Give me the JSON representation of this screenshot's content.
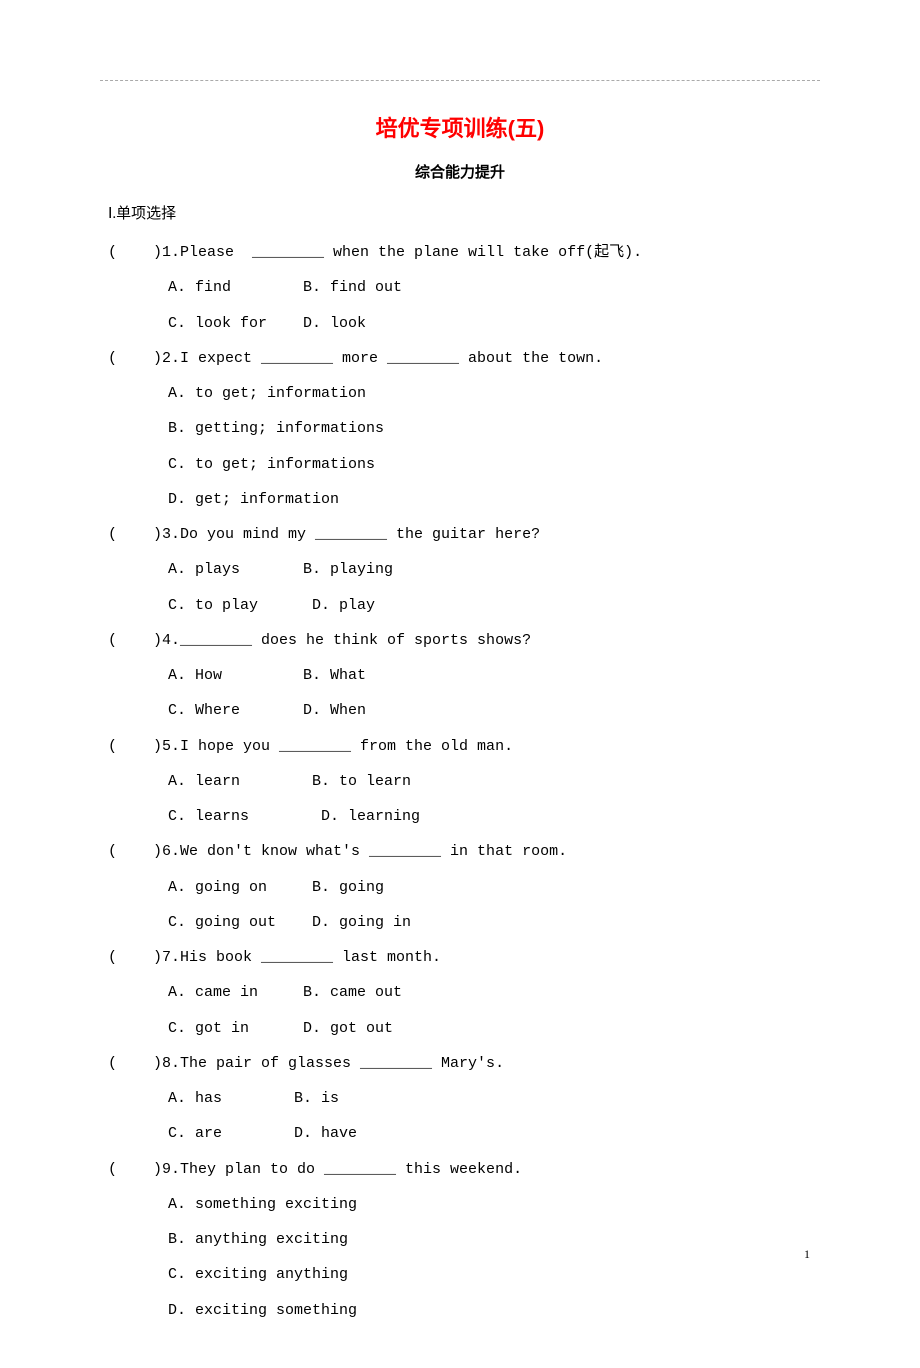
{
  "title": "培优专项训练(五)",
  "subtitle": "综合能力提升",
  "section_label": "Ⅰ.单项选择",
  "page_number": "1",
  "questions": [
    {
      "stem": "(    )1.Please  ________ when the plane will take off(起飞).",
      "row1": "A. find        B. find out",
      "row2": "C. look for    D. look"
    },
    {
      "stem": "(    )2.I expect ________ more ________ about the town.",
      "opt_a": "A. to get; information",
      "opt_b": "B. getting; informations",
      "opt_c": "C. to get; informations",
      "opt_d": "D. get; information"
    },
    {
      "stem": "(    )3.Do you mind my ________ the guitar here?",
      "row1": "A. plays       B. playing",
      "row2": "C. to play      D. play"
    },
    {
      "stem": "(    )4.________ does he think of sports shows?",
      "row1": "A. How         B. What",
      "row2": "C. Where       D. When"
    },
    {
      "stem": "(    )5.I hope you ________ from the old man.",
      "row1": "A. learn        B. to learn",
      "row2": "C. learns        D. learning"
    },
    {
      "stem": "(    )6.We don't know what's ________ in that room.",
      "row1": "A. going on     B. going",
      "row2": "C. going out    D. going in"
    },
    {
      "stem": "(    )7.His book ________ last month.",
      "row1": "A. came in     B. came out",
      "row2": "C. got in      D. got out"
    },
    {
      "stem": "(    )8.The pair of glasses ________ Mary's.",
      "row1": "A. has        B. is",
      "row2": "C. are        D. have"
    },
    {
      "stem": "(    )9.They plan to do ________ this weekend.",
      "opt_a": "A. something exciting",
      "opt_b": "B. anything exciting",
      "opt_c": "C. exciting anything",
      "opt_d": "D. exciting something"
    }
  ]
}
